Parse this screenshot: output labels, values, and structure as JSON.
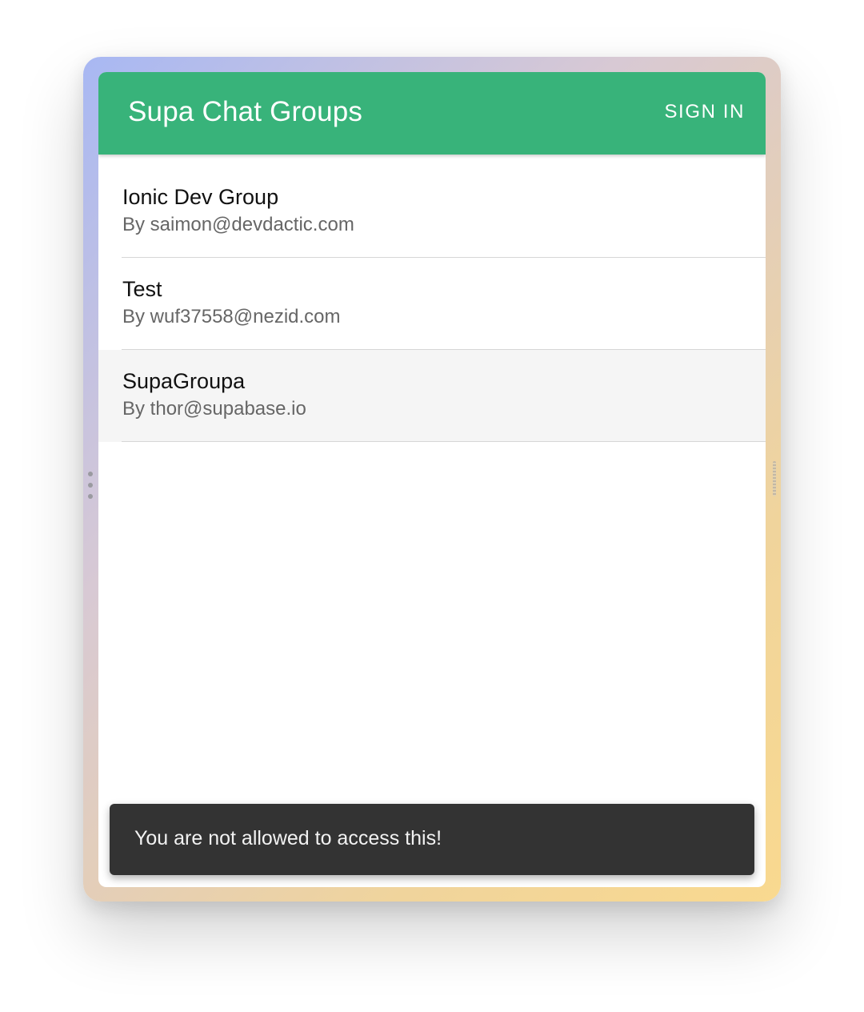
{
  "header": {
    "title": "Supa Chat Groups",
    "sign_in_label": "SIGN IN"
  },
  "groups": [
    {
      "title": "Ionic Dev Group",
      "subtitle": "By saimon@devdactic.com"
    },
    {
      "title": "Test",
      "subtitle": "By wuf37558@nezid.com"
    },
    {
      "title": "SupaGroupa",
      "subtitle": "By thor@supabase.io"
    }
  ],
  "toast": {
    "message": "You are not allowed to access this!"
  },
  "colors": {
    "toolbar": "#38b37a",
    "toast_bg": "#333333",
    "highlight_row": "#f5f5f5"
  }
}
